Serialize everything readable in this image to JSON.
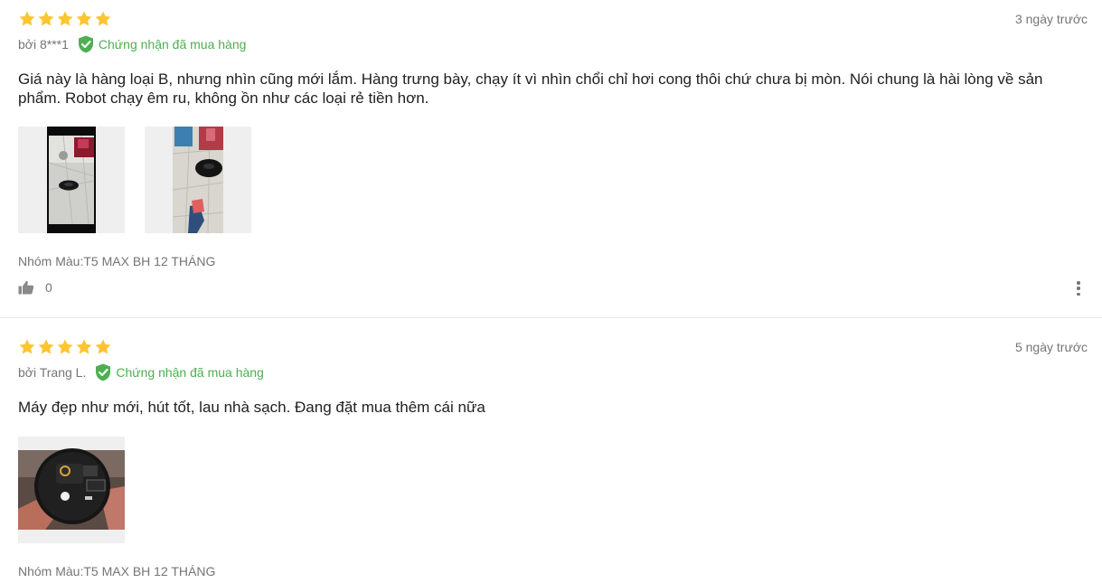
{
  "reviews": [
    {
      "rating": 5,
      "time": "3 ngày trước",
      "author": "bởi 8***1",
      "verified_label": "Chứng nhận đã mua hàng",
      "content": "Giá này là hàng loại B, nhưng nhìn cũng mới lắm. Hàng trưng bày, chạy ít vì nhìn chổi chỉ hơi cong thôi chứ chưa bị mòn. Nói chung là hài lòng về sản phẩm. Robot chạy êm ru, không ồn như các loại rẻ tiền hơn.",
      "variant": "Nhóm Màu:T5 MAX BH 12 THÁNG",
      "likes": "0"
    },
    {
      "rating": 5,
      "time": "5 ngày trước",
      "author": "bởi Trang L.",
      "verified_label": "Chứng nhận đã mua hàng",
      "content": "Máy đẹp như mới, hút tốt, lau nhà sạch. Đang đặt mua thêm cái nữa",
      "variant": "Nhóm Màu:T5 MAX BH 12 THÁNG"
    }
  ],
  "colors": {
    "star": "#fcc531",
    "verified": "#4caf50",
    "muted": "#757575",
    "text": "#212121"
  },
  "icons": {
    "star": "star-icon",
    "verified": "shield-check-icon",
    "like": "thumbs-up-icon",
    "more": "more-vertical-icon"
  }
}
